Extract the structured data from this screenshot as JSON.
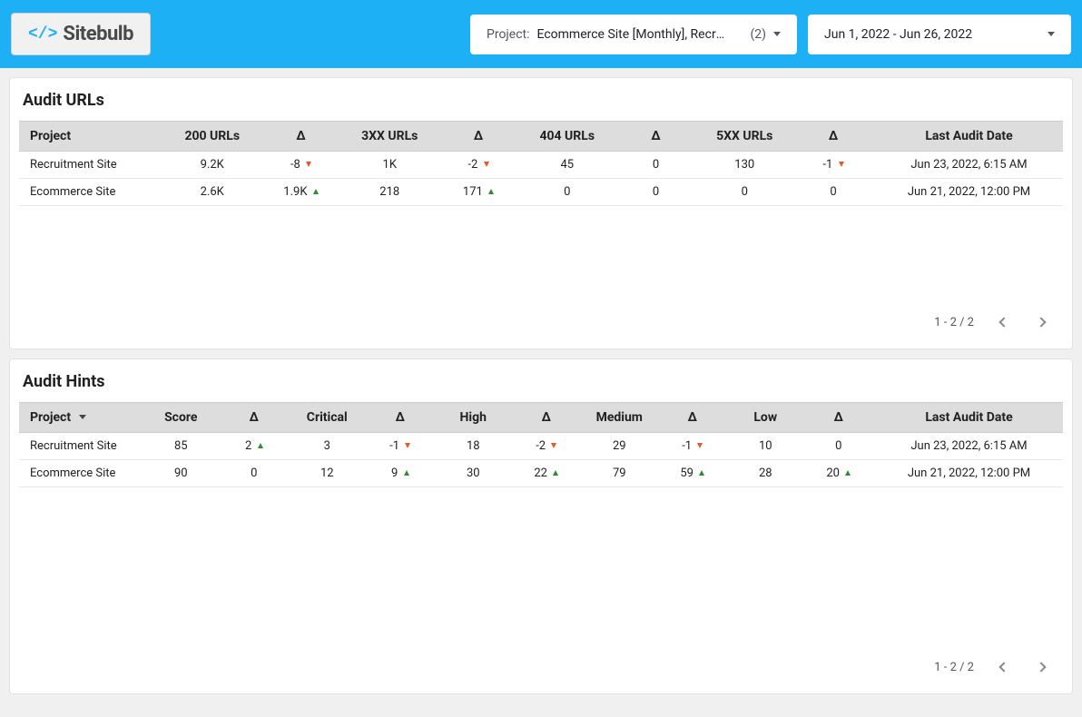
{
  "logo": {
    "icon_text": "</>",
    "name": "Sitebulb"
  },
  "project_selector": {
    "label": "Project:",
    "value": "Ecommerce Site [Monthly], Recruit…",
    "count": "(2)"
  },
  "date_range": "Jun 1, 2022 - Jun 26, 2022",
  "panels": {
    "urls": {
      "title": "Audit URLs",
      "columns": [
        "Project",
        "200 URLs",
        "Δ",
        "3XX URLs",
        "Δ",
        "404 URLs",
        "Δ",
        "5XX URLs",
        "Δ",
        "Last Audit Date"
      ],
      "rows": [
        {
          "project": "Recruitment Site",
          "c200": "9.2K",
          "d200": {
            "value": "-8",
            "dir": "down"
          },
          "c3xx": "1K",
          "d3xx": {
            "value": "-2",
            "dir": "down"
          },
          "c404": "45",
          "d404": {
            "value": "0",
            "dir": "none"
          },
          "c5xx": "130",
          "d5xx": {
            "value": "-1",
            "dir": "down"
          },
          "last": "Jun 23, 2022, 6:15 AM"
        },
        {
          "project": "Ecommerce Site",
          "c200": "2.6K",
          "d200": {
            "value": "1.9K",
            "dir": "up"
          },
          "c3xx": "218",
          "d3xx": {
            "value": "171",
            "dir": "up"
          },
          "c404": "0",
          "d404": {
            "value": "0",
            "dir": "none"
          },
          "c5xx": "0",
          "d5xx": {
            "value": "0",
            "dir": "none"
          },
          "last": "Jun 21, 2022, 12:00 PM"
        }
      ],
      "paging": "1 - 2 / 2"
    },
    "hints": {
      "title": "Audit Hints",
      "columns": [
        "Project",
        "Score",
        "Δ",
        "Critical",
        "Δ",
        "High",
        "Δ",
        "Medium",
        "Δ",
        "Low",
        "Δ",
        "Last Audit Date"
      ],
      "sort_on_project": true,
      "rows": [
        {
          "project": "Recruitment Site",
          "score": "85",
          "dscore": {
            "value": "2",
            "dir": "up"
          },
          "crit": "3",
          "dcrit": {
            "value": "-1",
            "dir": "down"
          },
          "high": "18",
          "dhigh": {
            "value": "-2",
            "dir": "down"
          },
          "med": "29",
          "dmed": {
            "value": "-1",
            "dir": "down"
          },
          "low": "10",
          "dlow": {
            "value": "0",
            "dir": "none"
          },
          "last": "Jun 23, 2022, 6:15 AM"
        },
        {
          "project": "Ecommerce Site",
          "score": "90",
          "dscore": {
            "value": "0",
            "dir": "none"
          },
          "crit": "12",
          "dcrit": {
            "value": "9",
            "dir": "up"
          },
          "high": "30",
          "dhigh": {
            "value": "22",
            "dir": "up"
          },
          "med": "79",
          "dmed": {
            "value": "59",
            "dir": "up"
          },
          "low": "28",
          "dlow": {
            "value": "20",
            "dir": "up"
          },
          "last": "Jun 21, 2022, 12:00 PM"
        }
      ],
      "paging": "1 - 2 / 2"
    }
  }
}
